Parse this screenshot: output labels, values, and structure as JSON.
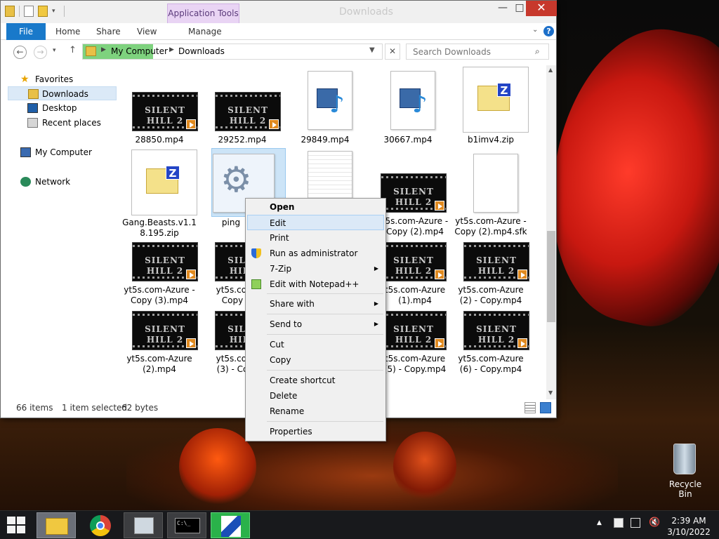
{
  "window": {
    "title": "Downloads",
    "app_tools_label": "Application Tools",
    "min": "—",
    "max": "□",
    "close": "✕"
  },
  "ribbon": {
    "file": "File",
    "home": "Home",
    "share": "Share",
    "view": "View",
    "manage": "Manage",
    "help": "?"
  },
  "address": {
    "crumb1": "My Computer",
    "crumb2": "Downloads",
    "search_placeholder": "Search Downloads"
  },
  "nav": {
    "favorites": "Favorites",
    "downloads": "Downloads",
    "desktop": "Desktop",
    "recent": "Recent places",
    "mycomputer": "My Computer",
    "network": "Network"
  },
  "files": [
    {
      "name": "28850.mp4"
    },
    {
      "name": "29252.mp4"
    },
    {
      "name": "29849.mp4"
    },
    {
      "name": "30667.mp4"
    },
    {
      "name": "b1imv4.zip"
    },
    {
      "name": "Gang.Beasts.v1.1",
      "name2": "8.195.zip"
    },
    {
      "name": "ping"
    },
    {
      "name": ""
    },
    {
      "name": "t5s.com-Azure -",
      "name2": "Copy (2).mp4"
    },
    {
      "name": "yt5s.com-Azure -",
      "name2": "Copy (2).mp4.sfk"
    },
    {
      "name": "yt5s.com-Azure -",
      "name2": "Copy (3).mp4"
    },
    {
      "name": "yt5s.coi",
      "name2": "Copy"
    },
    {
      "name": "t5s.com-Azure",
      "name2": "(1).mp4"
    },
    {
      "name": "yt5s.com-Azure",
      "name2": "(2) - Copy.mp4"
    },
    {
      "name": "yt5s.com-Azure",
      "name2": "(2).mp4"
    },
    {
      "name": "yt5s.coi",
      "name2": "(3) - Co"
    },
    {
      "name": "t5s.com-Azure",
      "name2": "(5) - Copy.mp4"
    },
    {
      "name": "yt5s.com-Azure",
      "name2": "(6) - Copy.mp4"
    }
  ],
  "video_thumb_text": "SILENT HILL 2",
  "status": {
    "items": "66 items",
    "selected": "1 item selected",
    "size": "62 bytes"
  },
  "context_menu": {
    "open": "Open",
    "edit": "Edit",
    "print": "Print",
    "runas": "Run as administrator",
    "zip": "7-Zip",
    "notepad": "Edit with Notepad++",
    "sharewith": "Share with",
    "sendto": "Send to",
    "cut": "Cut",
    "copy": "Copy",
    "shortcut": "Create shortcut",
    "delete": "Delete",
    "rename": "Rename",
    "properties": "Properties"
  },
  "desktop": {
    "recycle_bin": "Recycle Bin"
  },
  "taskbar": {
    "time": "2:39 AM",
    "date": "3/10/2022",
    "cmd_text": "C:\\_"
  },
  "colors": {
    "accent": "#1979ca",
    "close": "#c7382c",
    "app_tools": "#e9d4f4"
  }
}
